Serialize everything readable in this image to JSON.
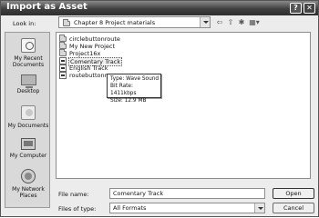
{
  "window": {
    "title": "Import as Asset",
    "help_glyph": "?",
    "close_glyph": "✕"
  },
  "lookin": {
    "label": "Look in:",
    "value": "Chapter 8 Project materials"
  },
  "toolbar": {
    "back": "⇦",
    "up": "⇧",
    "new_folder": "✱",
    "views": "▦▾"
  },
  "places": [
    {
      "label": "My Recent Documents",
      "icon": "recent-documents-icon"
    },
    {
      "label": "Desktop",
      "icon": "desktop-icon"
    },
    {
      "label": "My Documents",
      "icon": "my-documents-icon"
    },
    {
      "label": "My Computer",
      "icon": "my-computer-icon"
    },
    {
      "label": "My Network Places",
      "icon": "network-places-icon"
    }
  ],
  "files": [
    {
      "name": "circlebuttonroute",
      "type": "folder"
    },
    {
      "name": "My New Project",
      "type": "folder"
    },
    {
      "name": "Project16x",
      "type": "folder"
    },
    {
      "name": "Comentary Track",
      "type": "sound"
    },
    {
      "name": "English Track",
      "type": "sound"
    },
    {
      "name": "routebuttonmenu",
      "type": "sound"
    }
  ],
  "tooltip": {
    "type": "Type: Wave Sound",
    "bitrate": "Bit Rate: 1411kbps",
    "size": "Size: 12.9 MB"
  },
  "filename": {
    "label": "File name:",
    "value": "Comentary Track"
  },
  "filetype": {
    "label": "Files of type:",
    "value": "All Formats"
  },
  "buttons": {
    "open": "Open",
    "cancel": "Cancel"
  }
}
